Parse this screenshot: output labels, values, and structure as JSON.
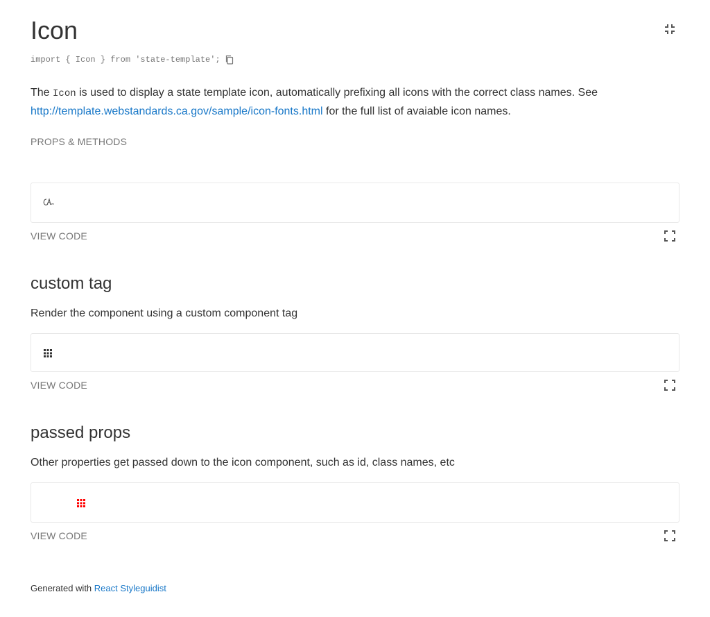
{
  "header": {
    "title": "Icon",
    "import_statement": "import { Icon } from 'state-template';"
  },
  "description": {
    "prefix": "The ",
    "code": "Icon",
    "middle": " is used to display a state template icon, automatically prefixing all icons with the correct class names. See ",
    "link_text": "http://template.webstandards.ca.gov/sample/icon-fonts.html",
    "suffix": " for the full list of avaiable icon names."
  },
  "props_methods_label": "PROPS & METHODS",
  "examples": [
    {
      "title": "",
      "description": "",
      "preview_icon": "ca-gov-logo-icon",
      "view_code_label": "VIEW CODE"
    },
    {
      "title": "custom tag",
      "description": "Render the component using a custom component tag",
      "preview_icon": "apps-grid-icon",
      "view_code_label": "VIEW CODE"
    },
    {
      "title": "passed props",
      "description": "Other properties get passed down to the icon component, such as id, class names, etc",
      "preview_icon": "apps-grid-icon",
      "icon_color": "#ff0000",
      "view_code_label": "VIEW CODE"
    }
  ],
  "footer": {
    "prefix": "Generated with ",
    "link_text": "React Styleguidist"
  },
  "colors": {
    "link": "#1978c8",
    "muted": "#767676",
    "text": "#333333",
    "border": "#e8e8e8"
  }
}
